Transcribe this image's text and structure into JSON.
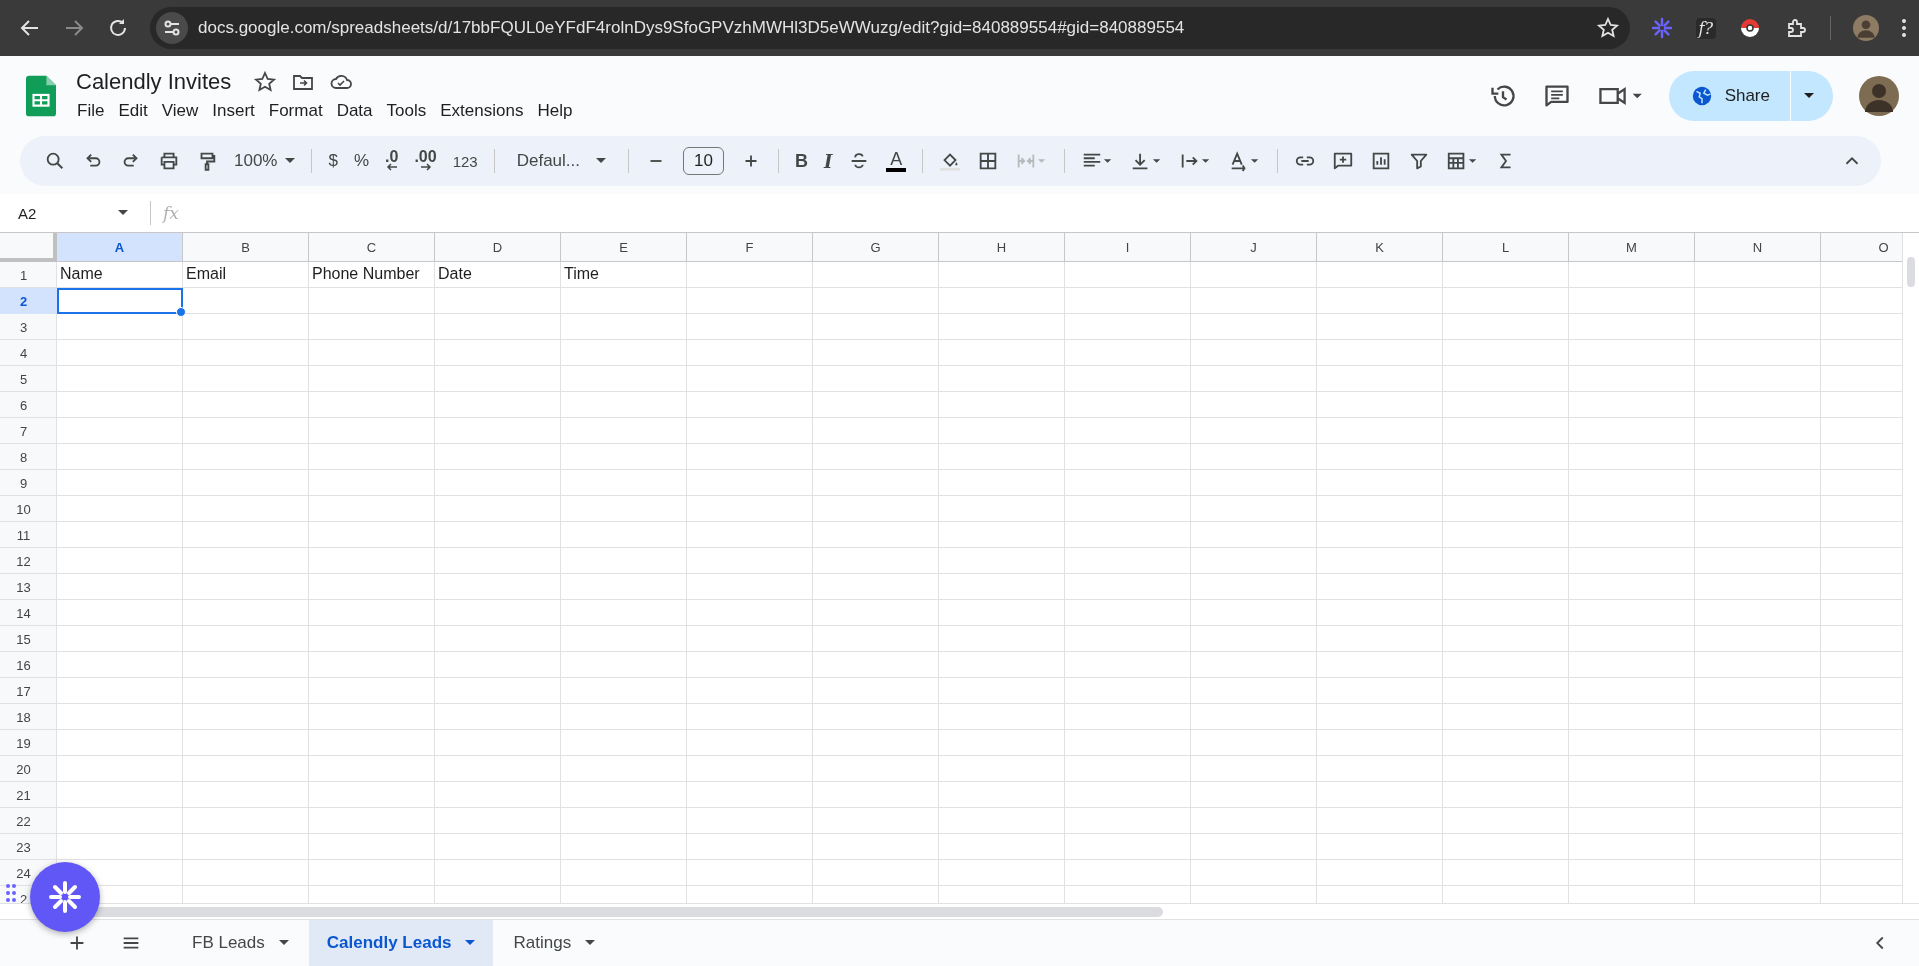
{
  "browser": {
    "url": "docs.google.com/spreadsheets/d/17bbFQUL0eYFdF4rolnDys9SfoGPVzhMWHl3D5eWWuzg/edit?gid=840889554#gid=840889554",
    "extension_label": "f?"
  },
  "document": {
    "title": "Calendly Invites",
    "menu": [
      "File",
      "Edit",
      "View",
      "Insert",
      "Format",
      "Data",
      "Tools",
      "Extensions",
      "Help"
    ]
  },
  "share_button": {
    "label": "Share"
  },
  "toolbar": {
    "zoom": "100%",
    "currency": "$",
    "percent": "%",
    "decrease_decimals": ".0",
    "increase_decimals": ".00",
    "number_format": "123",
    "font": "Defaul...",
    "font_size": "10",
    "bold": "B",
    "italic": "I",
    "text_color": "A",
    "merge_disabled": true
  },
  "formula_bar": {
    "name_box": "A2",
    "fx": "fx"
  },
  "sheet": {
    "columns": [
      {
        "label": "A",
        "selected": true
      },
      {
        "label": "B",
        "selected": false
      },
      {
        "label": "C",
        "selected": false
      },
      {
        "label": "D",
        "selected": false
      },
      {
        "label": "E",
        "selected": false
      },
      {
        "label": "F",
        "selected": false
      },
      {
        "label": "G",
        "selected": false
      },
      {
        "label": "H",
        "selected": false
      },
      {
        "label": "I",
        "selected": false
      },
      {
        "label": "J",
        "selected": false
      },
      {
        "label": "K",
        "selected": false
      },
      {
        "label": "L",
        "selected": false
      },
      {
        "label": "M",
        "selected": false
      },
      {
        "label": "N",
        "selected": false
      },
      {
        "label": "O",
        "selected": false
      }
    ],
    "rows": [
      {
        "label": "1",
        "selected": false,
        "cells": [
          "Name",
          "Email",
          "Phone Number",
          "Date",
          "Time"
        ]
      },
      {
        "label": "2",
        "selected": true
      },
      {
        "label": "3",
        "selected": false
      },
      {
        "label": "4",
        "selected": false
      },
      {
        "label": "5",
        "selected": false
      },
      {
        "label": "6",
        "selected": false
      },
      {
        "label": "7",
        "selected": false
      },
      {
        "label": "8",
        "selected": false
      },
      {
        "label": "9",
        "selected": false
      },
      {
        "label": "10",
        "selected": false
      },
      {
        "label": "11",
        "selected": false
      },
      {
        "label": "12",
        "selected": false
      },
      {
        "label": "13",
        "selected": false
      },
      {
        "label": "14",
        "selected": false
      },
      {
        "label": "15",
        "selected": false
      },
      {
        "label": "16",
        "selected": false
      },
      {
        "label": "17",
        "selected": false
      },
      {
        "label": "18",
        "selected": false
      },
      {
        "label": "19",
        "selected": false
      },
      {
        "label": "20",
        "selected": false
      },
      {
        "label": "21",
        "selected": false
      },
      {
        "label": "22",
        "selected": false
      },
      {
        "label": "23",
        "selected": false
      },
      {
        "label": "24",
        "selected": false
      },
      {
        "label": "2",
        "selected": false
      }
    ]
  },
  "sheet_tabs": [
    {
      "label": "FB Leads",
      "selected": false
    },
    {
      "label": "Calendly Leads",
      "selected": true
    },
    {
      "label": "Ratings",
      "selected": false
    }
  ]
}
